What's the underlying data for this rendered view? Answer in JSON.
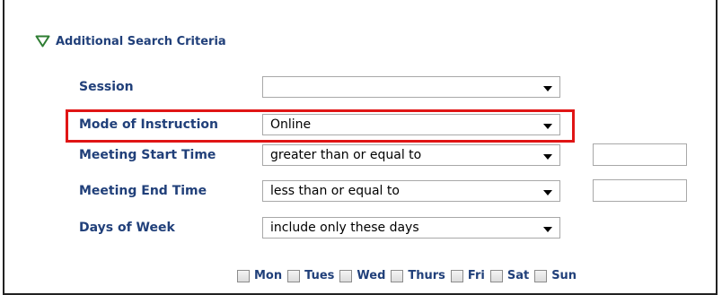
{
  "section": {
    "title": "Additional Search Criteria",
    "expanded_icon": "triangle-down-icon",
    "accent_color": "#21407a",
    "highlight_color": "#e01515"
  },
  "fields": {
    "session": {
      "label": "Session",
      "value": ""
    },
    "mode_of_instruction": {
      "label": "Mode of Instruction",
      "value": "Online"
    },
    "meeting_start_time": {
      "label": "Meeting Start Time",
      "operator": "greater than or equal to",
      "time_value": ""
    },
    "meeting_end_time": {
      "label": "Meeting End Time",
      "operator": "less than or equal to",
      "time_value": ""
    },
    "days_of_week": {
      "label": "Days of Week",
      "value": "include only these days"
    }
  },
  "days": [
    {
      "label": "Mon",
      "checked": false
    },
    {
      "label": "Tues",
      "checked": false
    },
    {
      "label": "Wed",
      "checked": false
    },
    {
      "label": "Thurs",
      "checked": false
    },
    {
      "label": "Fri",
      "checked": false
    },
    {
      "label": "Sat",
      "checked": false
    },
    {
      "label": "Sun",
      "checked": false
    }
  ]
}
